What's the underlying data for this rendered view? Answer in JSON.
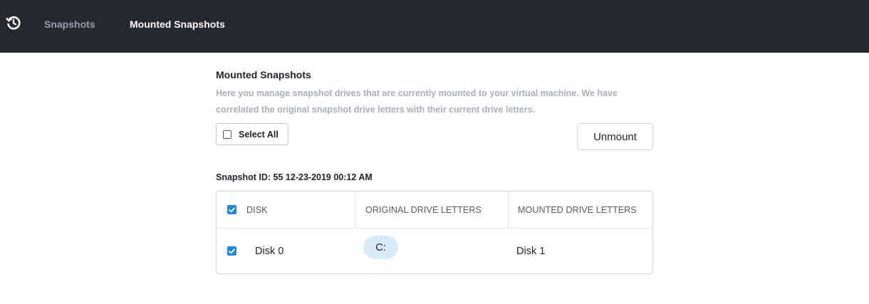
{
  "nav": {
    "logo_icon": "history-clock-icon",
    "items": [
      {
        "label": "Snapshots",
        "active": false
      },
      {
        "label": "Mounted Snapshots",
        "active": true
      }
    ]
  },
  "page": {
    "title": "Mounted Snapshots",
    "description": "Here you manage snapshot drives that are currently mounted to your virtual machine. We have correlated the original snapshot drive letters with their current drive letters."
  },
  "controls": {
    "select_all_label": "Select All",
    "select_all_checked": false,
    "unmount_label": "Unmount"
  },
  "snapshot": {
    "id_label": "Snapshot ID: 55  12-23-2019 00:12 AM"
  },
  "table": {
    "header_checked": true,
    "columns": [
      "DISK",
      "ORIGINAL DRIVE LETTERS",
      "MOUNTED DRIVE LETTERS"
    ],
    "rows": [
      {
        "checked": true,
        "disk": "Disk 0",
        "original": "C:",
        "mounted": "Disk 1"
      }
    ]
  },
  "colors": {
    "topbar": "#25282d",
    "accent": "#1e88e5",
    "chip_bg": "#d8ebfb"
  }
}
